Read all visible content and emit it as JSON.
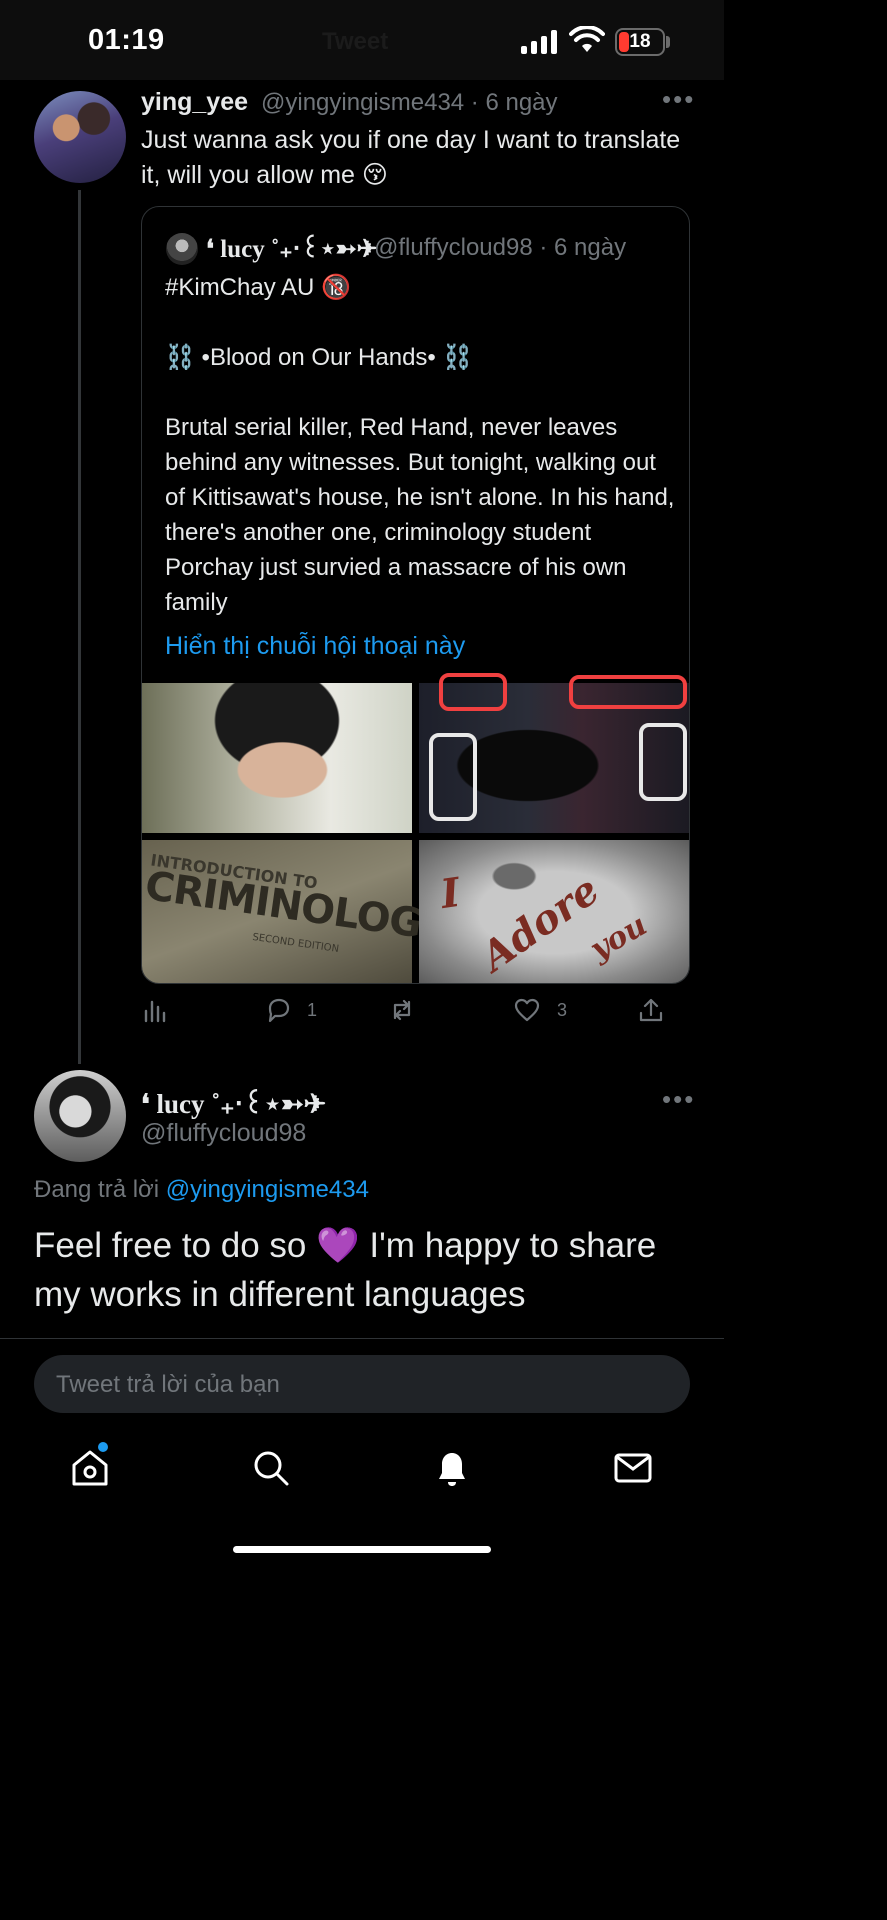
{
  "status_bar": {
    "time": "01:19",
    "battery": "18",
    "header_ghost": "Tweet"
  },
  "tweet": {
    "name": "ying_yee",
    "handle_time": "@yingyingisme434 · 6 ngày",
    "text": "Just wanna ask you if one day I want to translate it, will you allow me 😚",
    "quote": {
      "name": "❛ lucy ˚₊‧꒰⋆➳✈",
      "handle_time": "@fluffycloud98 · 6 ngày",
      "text": "#KimChay AU 🔞\n\n⛓️ •Blood on Our Hands• ⛓️\n\nBrutal serial killer, Red Hand, never leaves behind any witnesses. But tonight, walking out of Kittisawat's house, he isn't alone. In his hand, there's another one, criminology student Porchay just survied a massacre of his own family",
      "show_thread": "Hiển thị chuỗi hội thoại này",
      "media_text": {
        "book_line1": "INTRODUCTION TO",
        "book_line2": "CRIMINOLOGY",
        "book_line3": "SECOND EDITION",
        "sink_w1": "I",
        "sink_w2": "Adore",
        "sink_w3": "you"
      },
      "stats": {
        "replies": "1",
        "retweets": "",
        "likes": "3"
      }
    }
  },
  "reply": {
    "name": "❛ lucy ˚₊‧꒰⋆➳✈",
    "handle": "@fluffycloud98",
    "replying_prefix": "Đang trả lời ",
    "replying_to": "@yingyingisme434",
    "text": "Feel free to do so 💜 I'm happy to share my works in different languages"
  },
  "compose": {
    "placeholder": "Tweet trả lời của bạn"
  },
  "nav": [
    "home-icon",
    "search-icon",
    "bell-icon",
    "mail-icon"
  ],
  "colors": {
    "background": "#000000",
    "accent": "#1d9bf0",
    "secondary_text": "#71767b"
  }
}
